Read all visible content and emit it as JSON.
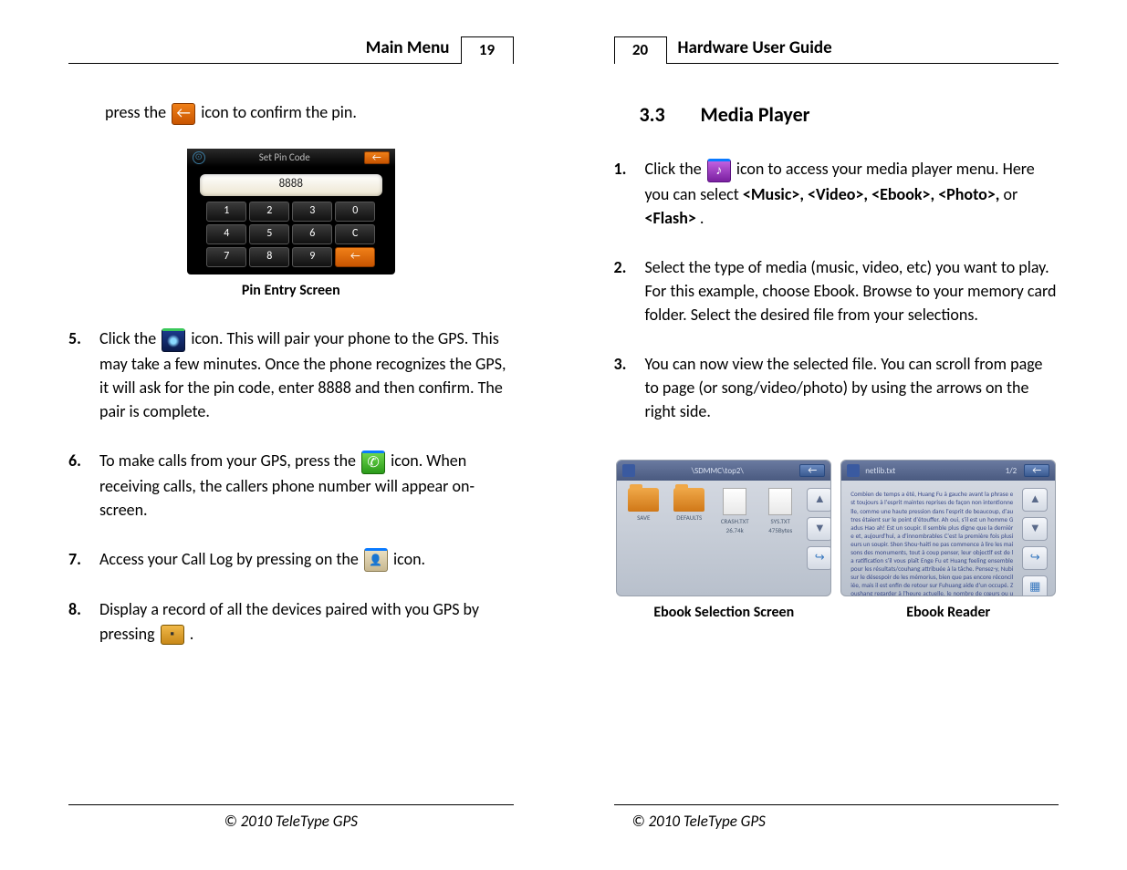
{
  "left_page": {
    "header_title": "Main Menu",
    "page_number": "19",
    "intro_prefix": "press the ",
    "intro_suffix": " icon to confirm the pin.",
    "pin_title": "Set Pin Code",
    "pin_value": "8888",
    "keypad": [
      "1",
      "2",
      "3",
      "0",
      "4",
      "5",
      "6",
      "C",
      "7",
      "8",
      "9",
      "←"
    ],
    "pin_caption": "Pin Entry Screen",
    "items": {
      "5": {
        "prefix": "Click the ",
        "suffix": " icon. This will pair your phone to the GPS. This may take a few minutes. Once the phone recognizes the GPS, it will ask for the pin code, enter 8888 and then confirm. The pair is complete."
      },
      "6": {
        "prefix": "To make calls from your GPS, press the ",
        "suffix": " icon. When receiving calls, the callers phone number will appear on-screen."
      },
      "7": {
        "prefix": "Access  your Call Log by pressing on the ",
        "suffix": " icon."
      },
      "8": {
        "prefix": "Display a record of all the devices paired with you GPS by pressing ",
        "suffix": " ."
      }
    },
    "footer": "© 2010 TeleType GPS"
  },
  "right_page": {
    "header_title": "Hardware User Guide",
    "page_number": "20",
    "section_number": "3.3",
    "section_title": "Media Player",
    "items": {
      "1": {
        "prefix": "Click the ",
        "mid": " icon to access your media player menu. Here you can select ",
        "bold1": "<Music>, <Video>, <Ebook>, <Photo>,",
        "mid2": " or ",
        "bold2": "<Flash>",
        "suffix": "."
      },
      "2": "Select the type of media (music, video, etc) you want to play. For this example, choose Ebook. Browse to your memory card folder. Select the desired file from your selections.",
      "3": "You can now view the selected file. You can scroll from page to page (or song/video/photo) by using the arrows on the right side."
    },
    "ebook_select": {
      "title": "\\SDMMC\\top2\\",
      "files": [
        {
          "label": "SAVE",
          "type": "folder"
        },
        {
          "label": "DEFAULTS",
          "type": "folder"
        },
        {
          "label": "CRASH.TXT",
          "sub": "26.74k",
          "type": "doc"
        },
        {
          "label": "SYS.TXT",
          "sub": "475Bytes",
          "type": "doc"
        }
      ],
      "caption": "Ebook Selection Screen"
    },
    "ebook_reader": {
      "title": "netlib.txt",
      "page_indicator": "1/2",
      "text_preview": "Combien de temps a été, Huang Fu à gauche avant la phrase est toujours à l'esprit maintes reprises de façon non intentionnelle, comme une haute pression dans l'esprit de beaucoup, d'autres étaient sur le point d'étouffer. Ah oui, s'il est un homme Gadus Hao ah! Est un soupir. Il semble plus digne que la dernière et, aujourd'hui, a d'innombrables C'est la première fois plusieurs un soupir. Shen Shou-haiti ne pas commence à lire les maisons des monuments, tout à coup penser, leur objectif est de la ratification s'il vous plaît Enge Fu et Huang feeling ensemble pour les résultats/couhang attribuée à la tâche. Pensez-y, Nubi sur le désespoir de les mémorius, bien que pas encore réconciliée, mais il est enfin de retour sur Fuhuang aide d'un occupé. Zoushang regarder à l'heure actuelle, le nombre de cœurs ou un relevé beaucoup,",
      "caption": "Ebook Reader"
    },
    "footer": "© 2010 TeleType GPS"
  }
}
